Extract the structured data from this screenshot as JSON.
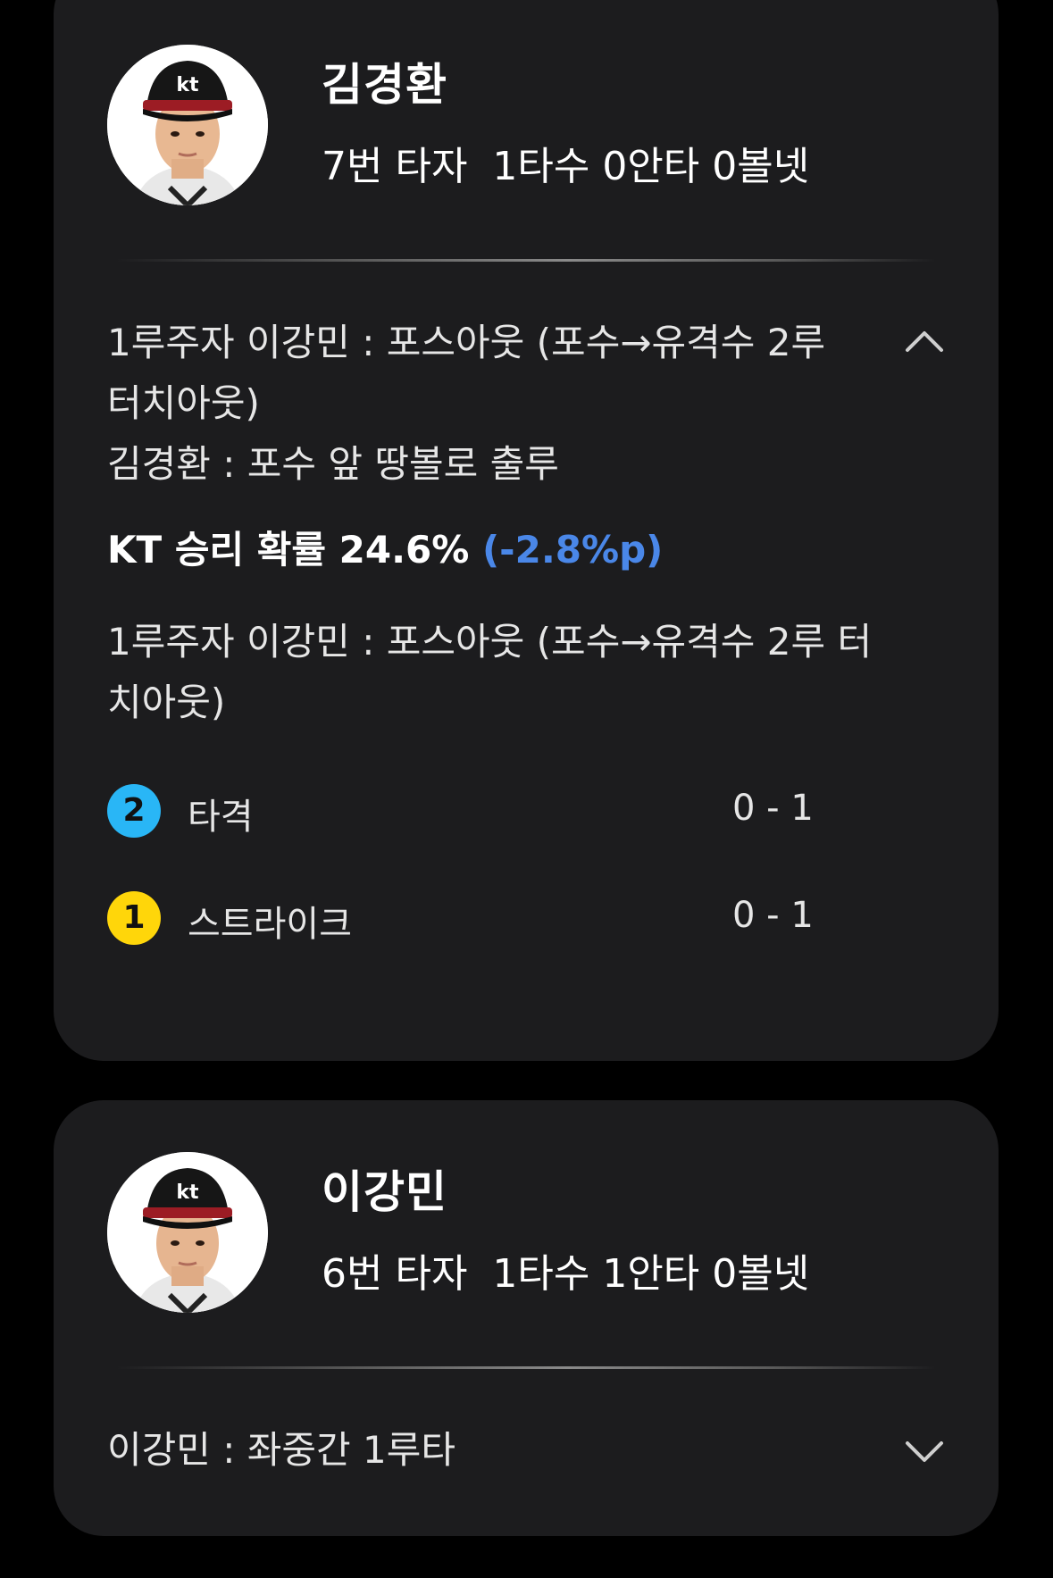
{
  "cards": [
    {
      "player_name": "김경환",
      "statline": "7번 타자  1타수 0안타 0볼넷",
      "play_summary_lines": [
        "1루주자 이강민 : 포스아웃 (포수→유격수 2루",
        "터치아웃)",
        "김경환 : 포수 앞 땅볼로 출루"
      ],
      "win_prob_label": "KT 승리 확률 24.6%",
      "win_prob_delta": "(-2.8%p)",
      "win_prob_delta_color": "#4a87e8",
      "event_description_lines": [
        "1루주자 이강민 : 포스아웃 (포수→유격수 2루 터",
        "치아웃)"
      ],
      "pitches": [
        {
          "number": "2",
          "label": "타격",
          "count": "0 - 1",
          "color": "#29b6f6"
        },
        {
          "number": "1",
          "label": "스트라이크",
          "count": "0 - 1",
          "color": "#ffd60a"
        }
      ],
      "toggle_icon": "chevron-up-icon"
    },
    {
      "player_name": "이강민",
      "statline": "6번 타자  1타수 1안타 0볼넷",
      "play_summary_lines": [
        "이강민 : 좌중간 1루타"
      ],
      "toggle_icon": "chevron-down-icon"
    }
  ],
  "team_logo_icon": "kt-wiz-logo"
}
